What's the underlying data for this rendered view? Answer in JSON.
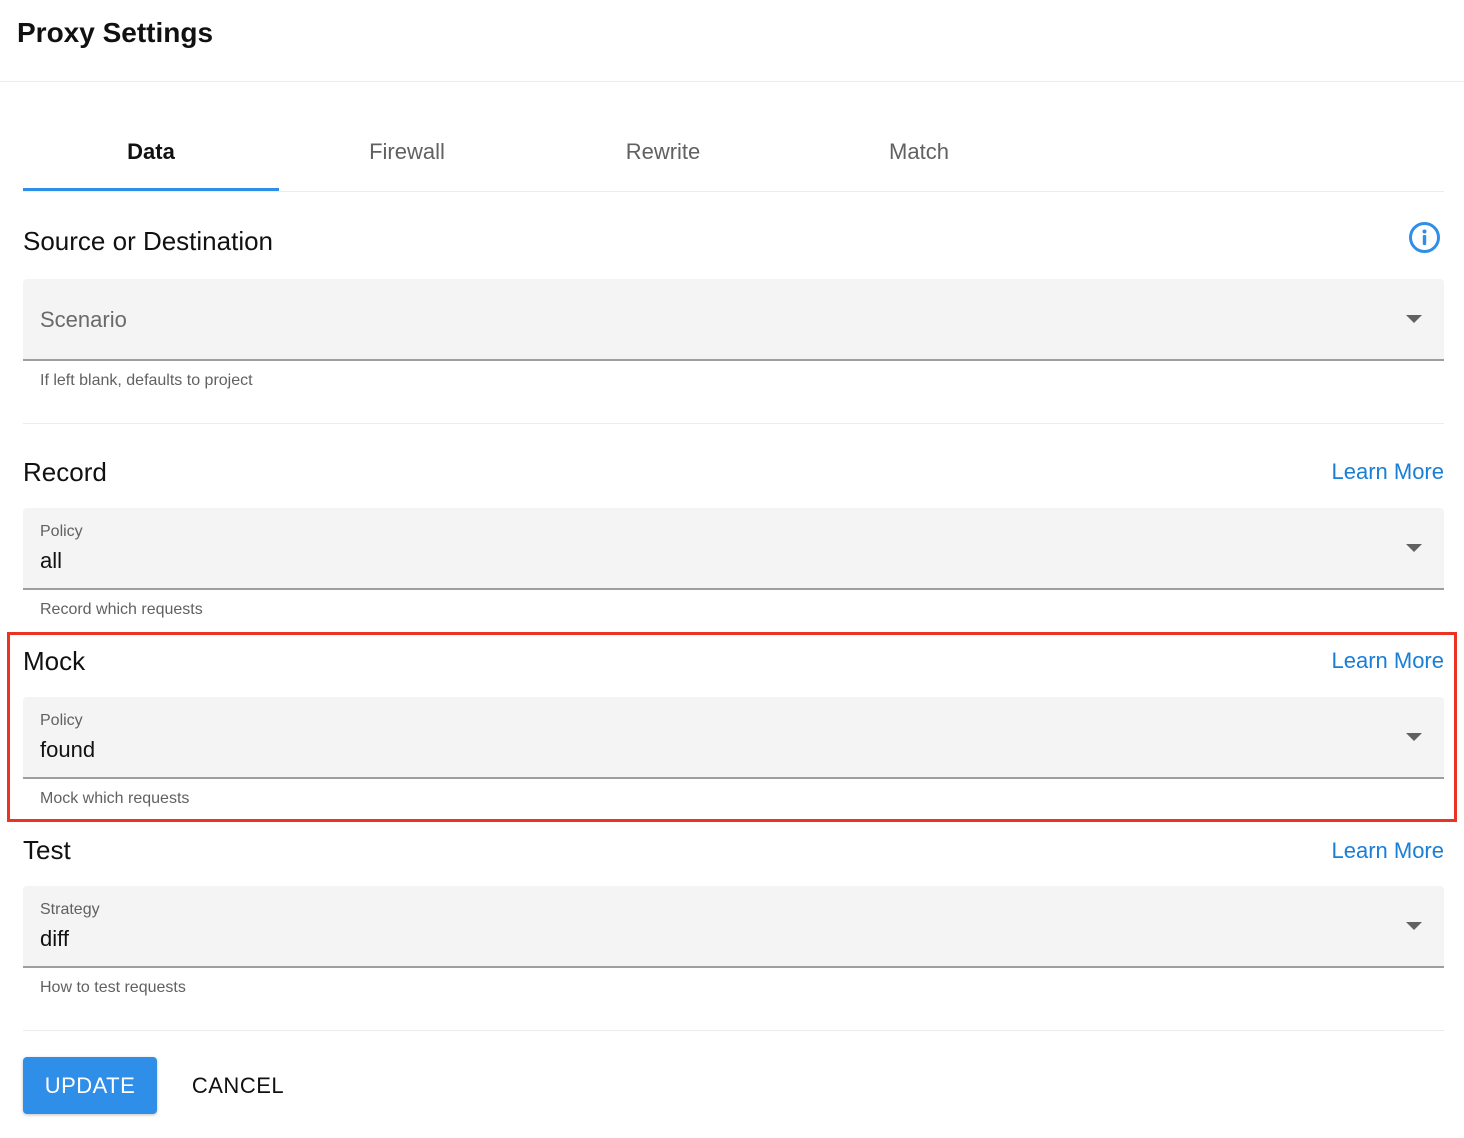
{
  "header": {
    "title": "Proxy Settings"
  },
  "tabs": [
    {
      "label": "Data",
      "active": true
    },
    {
      "label": "Firewall",
      "active": false
    },
    {
      "label": "Rewrite",
      "active": false
    },
    {
      "label": "Match",
      "active": false
    }
  ],
  "source": {
    "title": "Source or Destination",
    "info_icon": "info-icon",
    "select_placeholder": "Scenario",
    "helper": "If left blank, defaults to project"
  },
  "record": {
    "title": "Record",
    "learn_more": "Learn More",
    "select_label": "Policy",
    "select_value": "all",
    "helper": "Record which requests"
  },
  "mock": {
    "title": "Mock",
    "learn_more": "Learn More",
    "select_label": "Policy",
    "select_value": "found",
    "helper": "Mock which requests",
    "highlight_color": "#ea3323"
  },
  "test": {
    "title": "Test",
    "learn_more": "Learn More",
    "select_label": "Strategy",
    "select_value": "diff",
    "helper": "How to test requests"
  },
  "actions": {
    "update_label": "UPDATE",
    "cancel_label": "CANCEL"
  },
  "colors": {
    "accent": "#2f8ee8",
    "link": "#1a7ed6",
    "field_bg": "#f4f4f4"
  }
}
